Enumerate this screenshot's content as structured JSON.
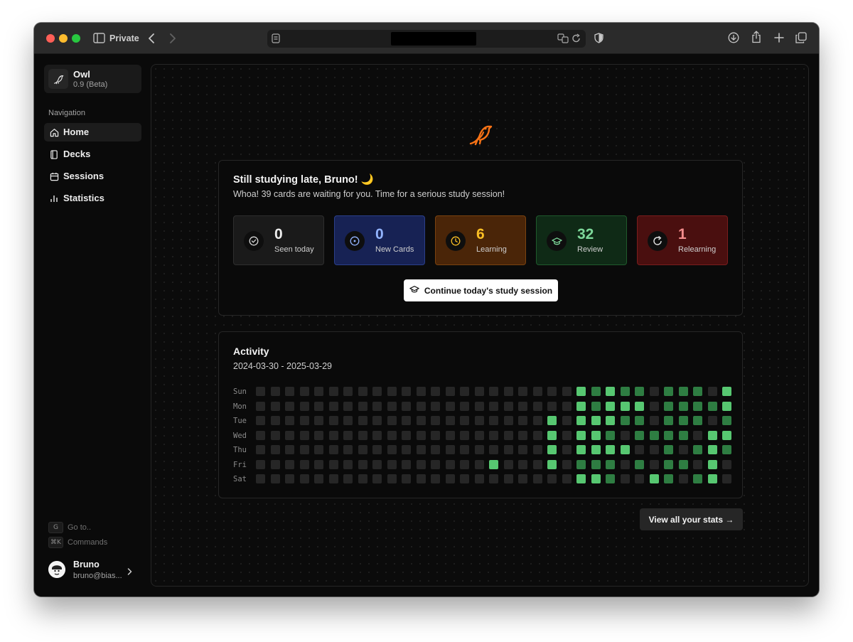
{
  "browser": {
    "private_label": "Private",
    "url": ""
  },
  "app": {
    "name": "Owl",
    "version": "0.9 (Beta)",
    "accent": "#f97316"
  },
  "sidebar": {
    "nav_heading": "Navigation",
    "items": [
      {
        "label": "Home",
        "icon": "home-icon",
        "active": true
      },
      {
        "label": "Decks",
        "icon": "book-icon",
        "active": false
      },
      {
        "label": "Sessions",
        "icon": "calendar-icon",
        "active": false
      },
      {
        "label": "Statistics",
        "icon": "bar-chart-icon",
        "active": false
      }
    ],
    "shortcuts": [
      {
        "key": "G",
        "label": "Go to.."
      },
      {
        "key": "⌘K",
        "label": "Commands"
      }
    ],
    "user": {
      "name": "Bruno",
      "email": "bruno@bias..."
    }
  },
  "welcome": {
    "greeting": "Still studying late, Bruno! 🌙",
    "subtitle": "Whoa! 39 cards are waiting for you. Time for a serious study session!",
    "stats": [
      {
        "value": "0",
        "label": "Seen today",
        "icon": "check-circle-icon",
        "color": "#ededed"
      },
      {
        "value": "0",
        "label": "New Cards",
        "icon": "target-icon",
        "color": "#93b4ff"
      },
      {
        "value": "6",
        "label": "Learning",
        "icon": "clock-icon",
        "color": "#fbbf24"
      },
      {
        "value": "32",
        "label": "Review",
        "icon": "graduation-cap-icon",
        "color": "#7dd89a"
      },
      {
        "value": "1",
        "label": "Relearning",
        "icon": "refresh-icon",
        "color": "#f48c8c"
      }
    ],
    "continue_label": "Continue today's study session"
  },
  "activity": {
    "title": "Activity",
    "range": "2024-03-30 - 2025-03-29",
    "days": [
      "Sun",
      "Mon",
      "Tue",
      "Wed",
      "Thu",
      "Fri",
      "Sat"
    ],
    "levels": [
      [
        0,
        0,
        0,
        0,
        0,
        0,
        0,
        0,
        0,
        0,
        0,
        0,
        0,
        0,
        0,
        0,
        0,
        0,
        0,
        0,
        0,
        0,
        3,
        2,
        3,
        2,
        2,
        0,
        2,
        2,
        2,
        0,
        3
      ],
      [
        0,
        0,
        0,
        0,
        0,
        0,
        0,
        0,
        0,
        0,
        0,
        0,
        0,
        0,
        0,
        0,
        0,
        0,
        0,
        0,
        0,
        0,
        3,
        2,
        3,
        3,
        3,
        0,
        2,
        2,
        2,
        2,
        3
      ],
      [
        0,
        0,
        0,
        0,
        0,
        0,
        0,
        0,
        0,
        0,
        0,
        0,
        0,
        0,
        0,
        0,
        0,
        0,
        0,
        0,
        3,
        0,
        3,
        3,
        3,
        2,
        2,
        0,
        2,
        2,
        2,
        0,
        2
      ],
      [
        0,
        0,
        0,
        0,
        0,
        0,
        0,
        0,
        0,
        0,
        0,
        0,
        0,
        0,
        0,
        0,
        0,
        0,
        0,
        0,
        3,
        0,
        3,
        3,
        2,
        0,
        2,
        2,
        2,
        2,
        0,
        3,
        3
      ],
      [
        0,
        0,
        0,
        0,
        0,
        0,
        0,
        0,
        0,
        0,
        0,
        0,
        0,
        0,
        0,
        0,
        0,
        0,
        0,
        0,
        3,
        0,
        3,
        3,
        3,
        3,
        0,
        0,
        2,
        0,
        2,
        3,
        2
      ],
      [
        0,
        0,
        0,
        0,
        0,
        0,
        0,
        0,
        0,
        0,
        0,
        0,
        0,
        0,
        0,
        0,
        3,
        0,
        0,
        0,
        3,
        0,
        2,
        2,
        2,
        0,
        2,
        0,
        2,
        2,
        0,
        3,
        0
      ],
      [
        0,
        0,
        0,
        0,
        0,
        0,
        0,
        0,
        0,
        0,
        0,
        0,
        0,
        0,
        0,
        0,
        0,
        0,
        0,
        0,
        0,
        0,
        3,
        3,
        2,
        0,
        0,
        3,
        2,
        0,
        2,
        3,
        0
      ]
    ],
    "colors": [
      "#262626",
      "#1f4d2b",
      "#2e7d42",
      "#57c771",
      "#8fe6a5"
    ],
    "stats_link": "View all your stats →"
  }
}
